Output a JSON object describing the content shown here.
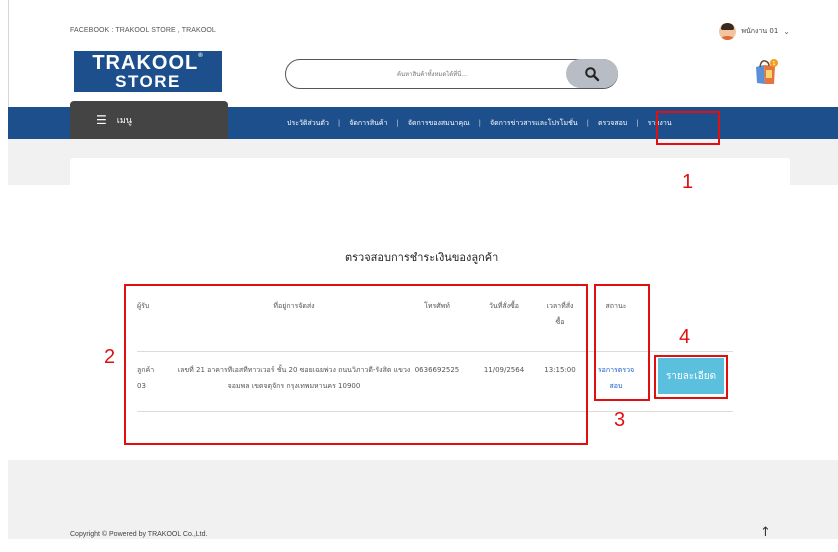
{
  "topbar": {
    "facebook_text": "FACEBOOK : TRAKOOL STORE , TRAKOOL",
    "user_name": "พนักงาน 01",
    "user_chevron": "⌄"
  },
  "logo": {
    "line1": "TRAKOOL",
    "line2": "STORE",
    "reg_mark": "®"
  },
  "search": {
    "placeholder": "ค้นหาสินค้าทั้งหมดได้ที่นี่..."
  },
  "nav": {
    "menu_label": "เมนู",
    "links": [
      "ประวัติส่วนตัว",
      "จัดการสินค้า",
      "จัดการของสมนาคุณ",
      "จัดการข่าวสารและโปรโมชั่น",
      "ตรวจสอบ",
      "รายงาน"
    ]
  },
  "page": {
    "title": "ตรวจสอบการชำระเงินของลูกค้า"
  },
  "table": {
    "headers": {
      "receiver": "ผู้รับ",
      "address": "ที่อยู่การจัดส่ง",
      "phone": "โทรศัพท์",
      "order_date": "วันที่สั่งซื้อ",
      "order_time": "เวลาที่สั่งซื้อ",
      "status": "สถานะ"
    },
    "rows": [
      {
        "receiver": "ลูกค้า 03",
        "address": "เลขที่ 21 อาคารทีเอสทีทาวเวอร์ ชั้น 20 ซอยเฉยพ่วง ถนนวิภาวดี-รังสิต แขวงจอมพล เขตจตุจักร กรุงเทพมหานคร 10900",
        "phone": "0636692525",
        "order_date": "11/09/2564",
        "order_time": "13:15:00",
        "status": "รอการตรวจสอบ",
        "action": "รายละเอียด"
      }
    ]
  },
  "annotations": {
    "n1": "1",
    "n2": "2",
    "n3": "3",
    "n4": "4"
  },
  "footer": {
    "copyright": "Copyright © Powered by TRAKOOL Co.,Ltd.",
    "back_to_top": "↑"
  },
  "colors": {
    "brand_blue": "#1d4f8c",
    "menu_dark": "#444444",
    "button_cyan": "#5bc0de",
    "annotation_red": "#e01010",
    "status_link": "#1a5fc7"
  }
}
